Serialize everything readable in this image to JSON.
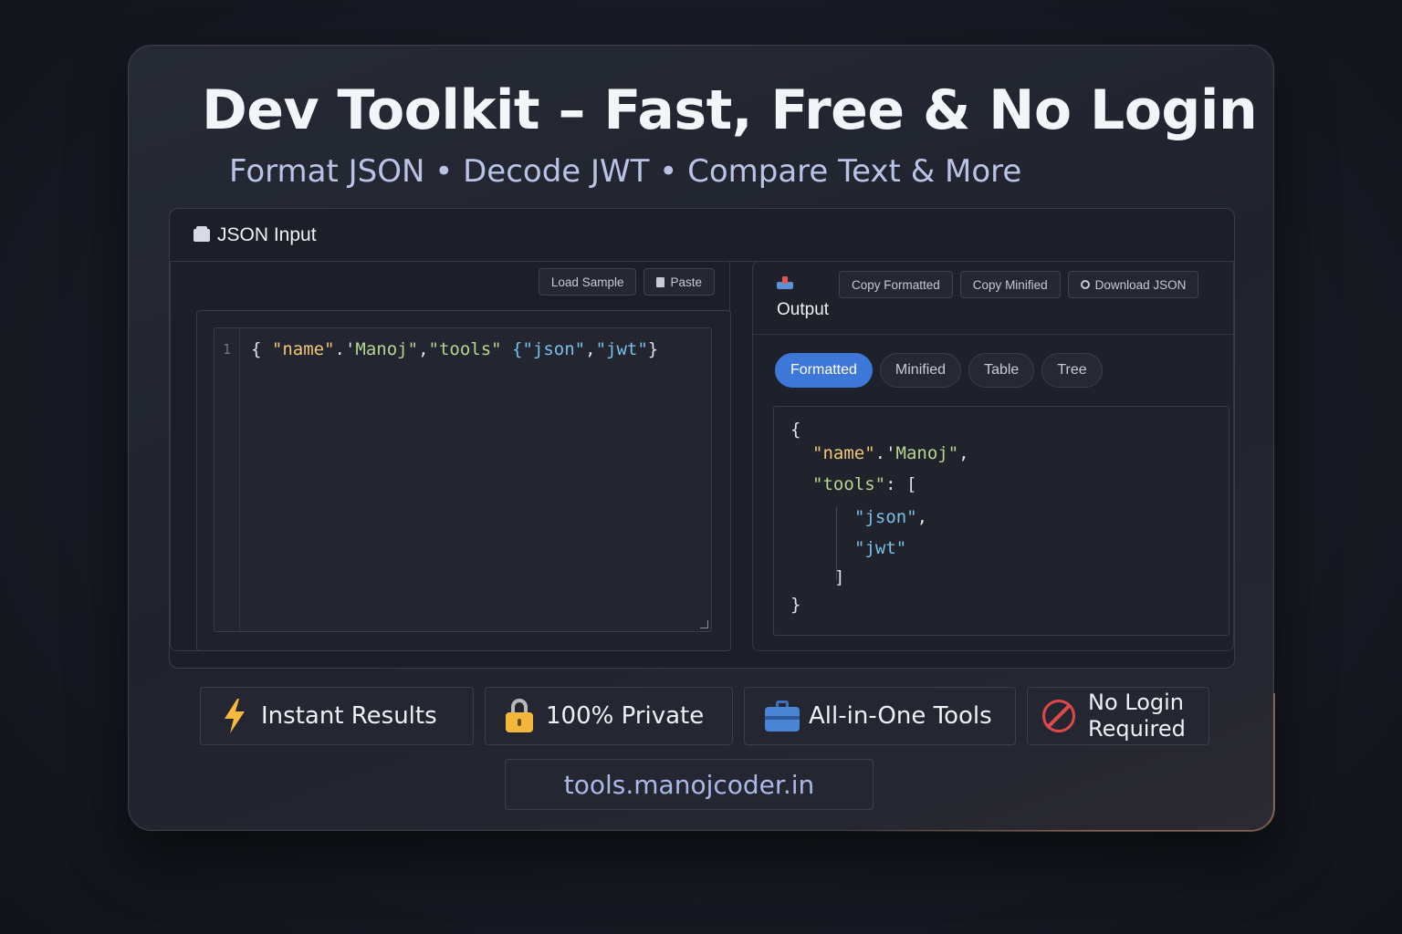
{
  "header": {
    "title": "Dev Toolkit – Fast, Free & No Login",
    "subtitle": "Format JSON • Decode JWT • Compare Text & More"
  },
  "input_panel": {
    "title": "JSON Input",
    "icon": "inbox-icon",
    "load_sample_label": "Load Sample",
    "paste_label": "Paste",
    "line_number": "1",
    "code": {
      "open": "{ ",
      "key_name": "\"name\"",
      "sep1": ".'",
      "val_name": "Manoj\"",
      "comma1": ",",
      "key_tools": "\"tools\"",
      "arr_open": " {",
      "item1": "\"json\"",
      "comma2": ",",
      "item2": "\"jwt\"",
      "close": "}"
    }
  },
  "output_panel": {
    "title": "Output",
    "icon": "outbox-icon",
    "copy_formatted_label": "Copy Formatted",
    "copy_minified_label": "Copy Minified",
    "download_label": "Download JSON",
    "tabs": [
      {
        "label": "Formatted",
        "active": true
      },
      {
        "label": "Minified",
        "active": false
      },
      {
        "label": "Table",
        "active": false
      },
      {
        "label": "Tree",
        "active": false
      }
    ],
    "formatted": {
      "open_brace": "{",
      "name_key": "\"name\"",
      "name_sep": ".'",
      "name_val": "Manoj\"",
      "name_comma": ",",
      "tools_key": "\"tools\"",
      "tools_sep": ": [",
      "item1": "\"json\"",
      "item1_comma": ",",
      "item2": "\"jwt\"",
      "arr_close": "]",
      "close_brace": "}"
    }
  },
  "features": [
    {
      "label": "Instant Results",
      "icon": "lightning-icon"
    },
    {
      "label": "100% Private",
      "icon": "lock-icon"
    },
    {
      "label": "All-in-One Tools",
      "icon": "toolbox-icon"
    },
    {
      "label_line1": "No Login",
      "label_line2": "Required",
      "icon": "no-entry-icon"
    }
  ],
  "footer": {
    "url": "tools.manojcoder.in"
  },
  "colors": {
    "accent": "#3d77d8",
    "json_key": "#f0c674",
    "json_string": "#b6d58f",
    "json_array_item": "#79c0e8",
    "url_text": "#aab9e6"
  }
}
